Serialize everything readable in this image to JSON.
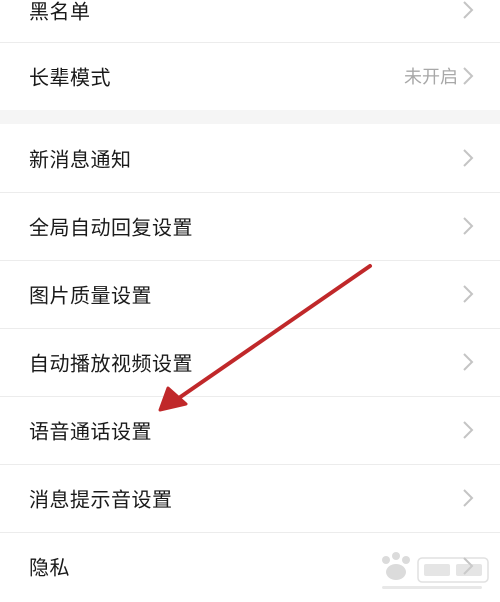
{
  "settings": {
    "group1": [
      {
        "label": "黑名单",
        "value": ""
      },
      {
        "label": "长辈模式",
        "value": "未开启"
      }
    ],
    "group2": [
      {
        "label": "新消息通知"
      },
      {
        "label": "全局自动回复设置"
      },
      {
        "label": "图片质量设置"
      },
      {
        "label": "自动播放视频设置"
      },
      {
        "label": "语音通话设置"
      },
      {
        "label": "消息提示音设置"
      },
      {
        "label": "隐私"
      }
    ]
  },
  "annotation": {
    "arrow_color": "#c0282a"
  },
  "colors": {
    "background": "#f5f5f5",
    "row_bg": "#ffffff",
    "text": "#1a1a1a",
    "value_text": "#a8a8a8",
    "chevron": "#c4c4c4"
  }
}
